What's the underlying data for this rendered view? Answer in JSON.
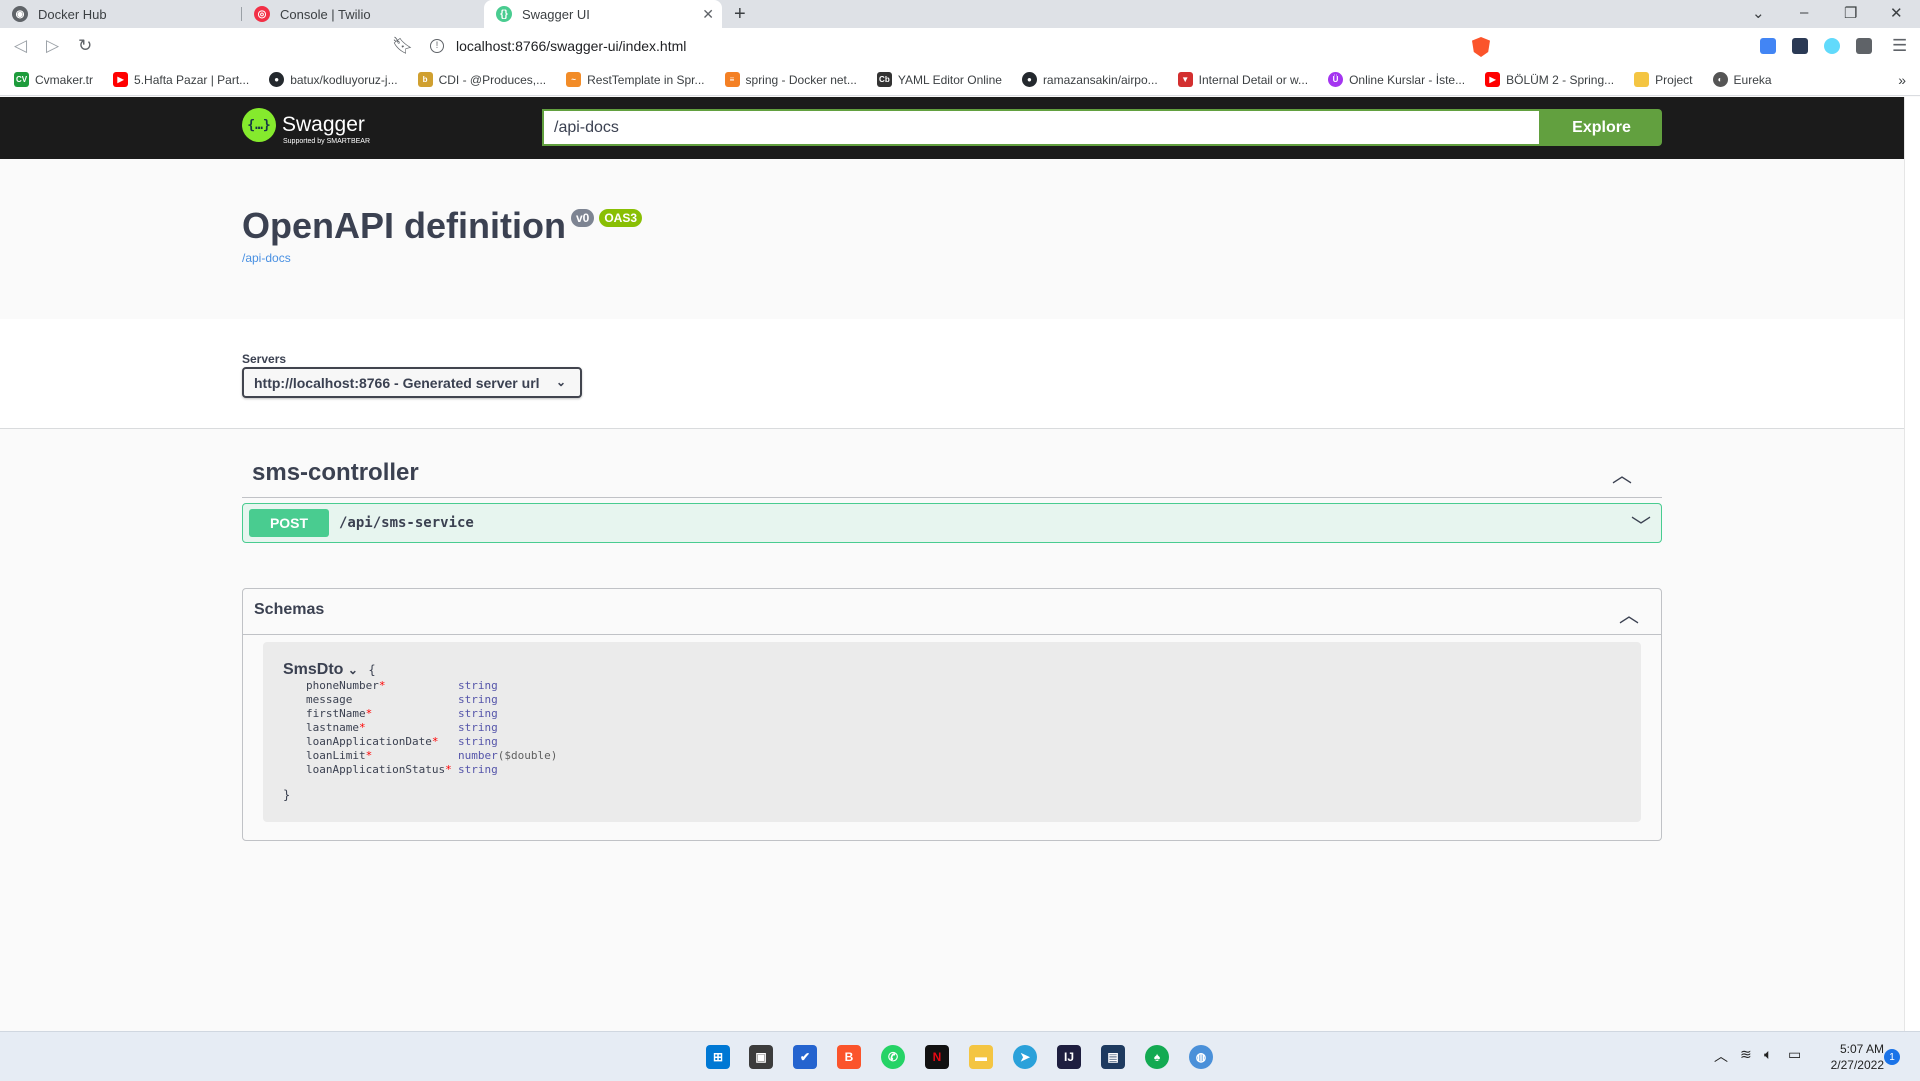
{
  "browser": {
    "tabs": [
      {
        "title": "Docker Hub",
        "color": "#5f6368",
        "glyph": "◉"
      },
      {
        "title": "Console | Twilio",
        "color": "#f22f46",
        "glyph": "◎"
      },
      {
        "title": "Swagger UI",
        "color": "#49cc90",
        "glyph": "{}"
      }
    ],
    "url": "localhost:8766/swagger-ui/index.html",
    "bookmarks": [
      {
        "label": "Cvmaker.tr",
        "color": "#1e9c3c",
        "glyph": "CV"
      },
      {
        "label": "5.Hafta Pazar | Part...",
        "color": "#ff0000",
        "glyph": "▶"
      },
      {
        "label": "batux/kodluyoruz-j...",
        "color": "#24292e",
        "glyph": "●"
      },
      {
        "label": "CDI - @Produces,...",
        "color": "#d0a030",
        "glyph": "b"
      },
      {
        "label": "RestTemplate in Spr...",
        "color": "#f28c28",
        "glyph": "~"
      },
      {
        "label": "spring - Docker net...",
        "color": "#f48024",
        "glyph": "≡"
      },
      {
        "label": "YAML Editor Online",
        "color": "#333333",
        "glyph": "Cb"
      },
      {
        "label": "ramazansakin/airpo...",
        "color": "#24292e",
        "glyph": "●"
      },
      {
        "label": "Internal Detail or w...",
        "color": "#d32f2f",
        "glyph": "▼"
      },
      {
        "label": "Online Kurslar - İste...",
        "color": "#a435f0",
        "glyph": "Ü"
      },
      {
        "label": "BÖLÜM 2 - Spring...",
        "color": "#ff0000",
        "glyph": "▶"
      },
      {
        "label": "Project",
        "color": "#f4c542",
        "glyph": ""
      },
      {
        "label": "Eureka",
        "color": "#555555",
        "glyph": "◐"
      }
    ]
  },
  "swagger": {
    "logo_name": "Swagger",
    "logo_sub": "Supported by SMARTBEAR",
    "search_value": "/api-docs",
    "explore_label": "Explore",
    "info": {
      "title": "OpenAPI definition",
      "version_badge": "v0",
      "oas_badge": "OAS3",
      "link": "/api-docs"
    },
    "servers": {
      "label": "Servers",
      "selected": "http://localhost:8766 - Generated server url"
    },
    "tag": {
      "name": "sms-controller",
      "operations": [
        {
          "method": "POST",
          "path": "/api/sms-service"
        }
      ]
    },
    "schemas": {
      "title": "Schemas",
      "models": [
        {
          "name": "SmsDto",
          "open_brace": "{",
          "close_brace": "}",
          "properties": [
            {
              "name": "phoneNumber",
              "required": "*",
              "type": "string",
              "format": ""
            },
            {
              "name": "message",
              "required": "",
              "type": "string",
              "format": ""
            },
            {
              "name": "firstName",
              "required": "*",
              "type": "string",
              "format": ""
            },
            {
              "name": "lastname",
              "required": "*",
              "type": "string",
              "format": ""
            },
            {
              "name": "loanApplicationDate",
              "required": "*",
              "type": "string",
              "format": ""
            },
            {
              "name": "loanLimit",
              "required": "*",
              "type": "number",
              "format": "($double)"
            },
            {
              "name": "loanApplicationStatus",
              "required": "*",
              "type": "string",
              "format": ""
            }
          ]
        }
      ]
    }
  },
  "taskbar": {
    "time": "5:07 AM",
    "date": "2/27/2022",
    "notifications": "1"
  }
}
